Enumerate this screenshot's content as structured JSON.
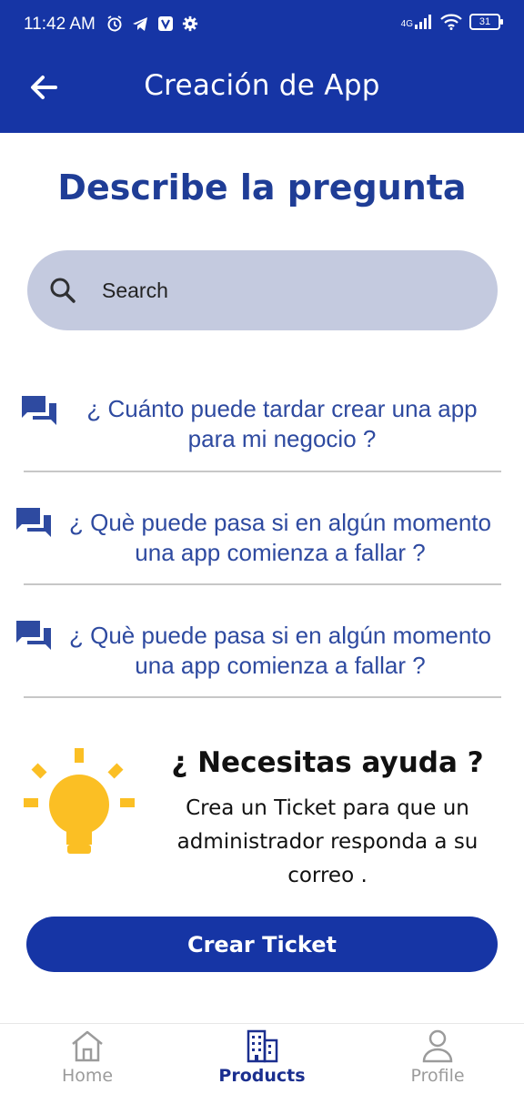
{
  "status_bar": {
    "time": "11:42 AM",
    "network": "4G",
    "battery": "31"
  },
  "app_bar": {
    "title": "Creación de App"
  },
  "page": {
    "title": "Describe la pregunta"
  },
  "search": {
    "placeholder": "Search",
    "value": ""
  },
  "faq": [
    {
      "question": "¿  Cuánto puede tardar crear una app para mi negocio ?"
    },
    {
      "question": "¿ Què puede pasa si en algún momento una app comienza a fallar  ?"
    },
    {
      "question": "¿ Què puede pasa si en algún momento una app comienza a fallar  ?"
    }
  ],
  "help": {
    "title": "¿ Necesitas ayuda ?",
    "text": "Crea un Ticket para que un administrador responda a su correo ."
  },
  "cta": {
    "label": "Crear Ticket"
  },
  "bottom_nav": {
    "items": [
      {
        "label": "Home",
        "icon": "home-icon",
        "active": false
      },
      {
        "label": "Products",
        "icon": "building-icon",
        "active": true
      },
      {
        "label": "Profile",
        "icon": "person-icon",
        "active": false
      }
    ]
  },
  "colors": {
    "primary": "#1635a5",
    "title_text": "#1f3d96",
    "faq_text": "#2e4aa0",
    "search_bg": "#c4cadf",
    "bulb": "#fbbf24"
  }
}
